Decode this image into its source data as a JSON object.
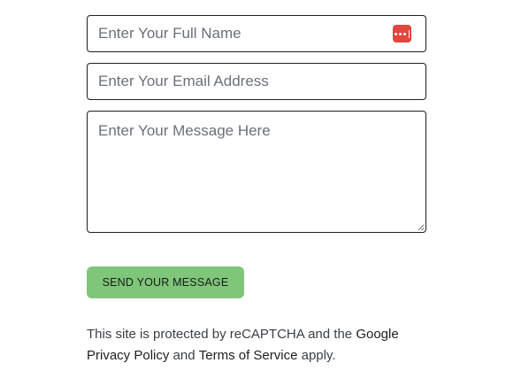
{
  "form": {
    "name_placeholder": "Enter Your Full Name",
    "email_placeholder": "Enter Your Email Address",
    "message_placeholder": "Enter Your Message Here",
    "submit_label": "SEND YOUR MESSAGE"
  },
  "recaptcha": {
    "text_before": "This site is protected by reCAPTCHA and the ",
    "google_label": "Google",
    "privacy_label": "Privacy Policy",
    "and_text": " and ",
    "terms_label": "Terms of Service",
    "text_after": " apply."
  },
  "icons": {
    "password_manager": "password-manager-icon",
    "resize": "resize-grip-icon"
  },
  "colors": {
    "button_background": "#7fc67a",
    "field_border": "#1e1e1e",
    "password_icon": "#e2463d"
  }
}
